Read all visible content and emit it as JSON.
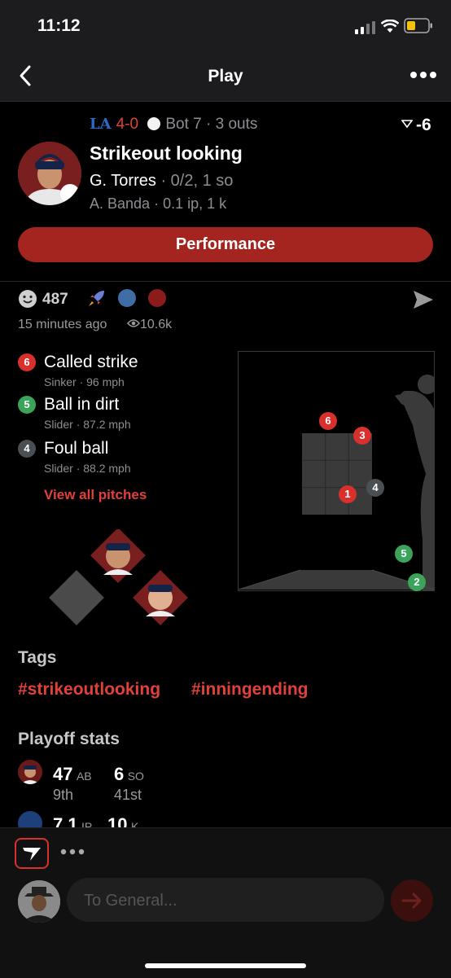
{
  "status_bar": {
    "time": "11:12"
  },
  "nav": {
    "title": "Play"
  },
  "play": {
    "score": "4-0",
    "inning": "Bot 7",
    "outs": "3 outs",
    "separator": "·",
    "win_expectancy": "-6",
    "title": "Strikeout looking",
    "batter_name": "G. Torres",
    "batter_line": "0/2, 1 so",
    "pitcher_name": "A. Banda",
    "pitcher_line": "0.1 ip, 1 k",
    "performance_label": "Performance"
  },
  "reactions": {
    "count": "487",
    "posted": "15 minutes ago",
    "views": "10.6k",
    "colors": [
      "#3f6ea6",
      "#8b1c1c"
    ]
  },
  "pitches": [
    {
      "num": "6",
      "result": "Called strike",
      "type": "Sinker",
      "speed": "96 mph",
      "color": "#d8302c"
    },
    {
      "num": "5",
      "result": "Ball in dirt",
      "type": "Slider",
      "speed": "87.2 mph",
      "color": "#3aa55a"
    },
    {
      "num": "4",
      "result": "Foul ball",
      "type": "Slider",
      "speed": "88.2 mph",
      "color": "#4a4f53"
    }
  ],
  "view_all_label": "View all pitches",
  "zone_pitches": [
    {
      "num": "6",
      "color": "#d8302c"
    },
    {
      "num": "3",
      "color": "#d8302c"
    },
    {
      "num": "1",
      "color": "#d8302c"
    },
    {
      "num": "4",
      "color": "#4a4f53"
    },
    {
      "num": "5",
      "color": "#3aa55a"
    },
    {
      "num": "2",
      "color": "#3aa55a"
    }
  ],
  "tags": {
    "title": "Tags",
    "items": [
      "#strikeoutlooking",
      "#inningending"
    ]
  },
  "playoff_stats": {
    "title": "Playoff stats",
    "rows": [
      {
        "stat1_value": "47",
        "stat1_unit": "AB",
        "stat1_rank": "9th",
        "stat2_value": "6",
        "stat2_unit": "SO",
        "stat2_rank": "41st"
      },
      {
        "stat1_value": "7.1",
        "stat1_unit": "IP",
        "stat2_value": "10",
        "stat2_unit": "K"
      }
    ]
  },
  "composer": {
    "placeholder": "To General..."
  },
  "accent_color": "#e0413a"
}
